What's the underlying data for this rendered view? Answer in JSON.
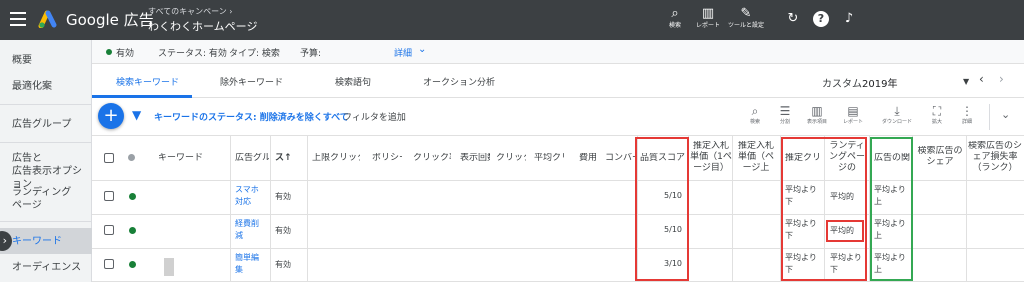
{
  "app": {
    "brand": "Google 広告",
    "breadcrumb": "すべてのキャンペーン ›",
    "campaign": "わくわくホームページ",
    "tools": [
      {
        "icon": "search-icon",
        "label": "検索"
      },
      {
        "icon": "report-icon",
        "label": "レポート"
      },
      {
        "icon": "wrench-icon",
        "label": "ツールと設定"
      }
    ]
  },
  "sidebar": {
    "items": [
      "概要",
      "最適化案",
      "広告グループ",
      "広告と\n広告表示オプション",
      "ランディング\nページ",
      "キーワード",
      "オーディエンス"
    ],
    "active": "キーワード"
  },
  "statusbar": {
    "status": "有効",
    "status_label": "ステータス: 有効",
    "type_label": "タイプ: 検索",
    "budget_label": "予算:",
    "details_label": "詳細"
  },
  "tabs": {
    "items": [
      "検索キーワード",
      "除外キーワード",
      "検索語句",
      "オークション分析"
    ],
    "date_label": "カスタム",
    "date_value": "2019年"
  },
  "filterbar": {
    "filter_text": "キーワードのステータス: 削除済みを除くすべて",
    "add_filter": "フィルタを追加",
    "tools": [
      "検索",
      "分割",
      "表示項目",
      "レポート",
      "ダウンロード",
      "拡大",
      "詳細"
    ]
  },
  "table": {
    "headers": [
      "キーワード",
      "広告グル",
      "ス↑",
      "上限クリック",
      "ポリシー",
      "クリック率",
      "表示回数",
      "クリック",
      "平均クリ",
      "費用",
      "コンバー",
      "品質スコア",
      "推定入札単価（1ページ目）",
      "推定入札単価（ページ上",
      "推定クリ",
      "ランディングページの",
      "広告の関",
      "検索広告のシェア",
      "検索広告のシェア損失率（ランク）"
    ],
    "rows": [
      {
        "ad_group": "スマホ\n対応",
        "status": "有効",
        "quality": "5/10",
        "ctr": "平均より\n下",
        "landing": "平均的",
        "relevance": "平均より\n上"
      },
      {
        "ad_group": "経費削\n減",
        "status": "有効",
        "quality": "5/10",
        "ctr": "平均より\n下",
        "landing": "平均的",
        "relevance": "平均より\n上"
      },
      {
        "ad_group": "簡単編\n集",
        "status": "有効",
        "quality": "3/10",
        "ctr": "平均より\n下",
        "landing": "平均より\n下",
        "relevance": "平均より\n上"
      }
    ]
  },
  "colors": {
    "accent": "#1a73e8",
    "highlight_red": "#e53935",
    "highlight_green": "#34a853",
    "status_green": "#188038"
  }
}
